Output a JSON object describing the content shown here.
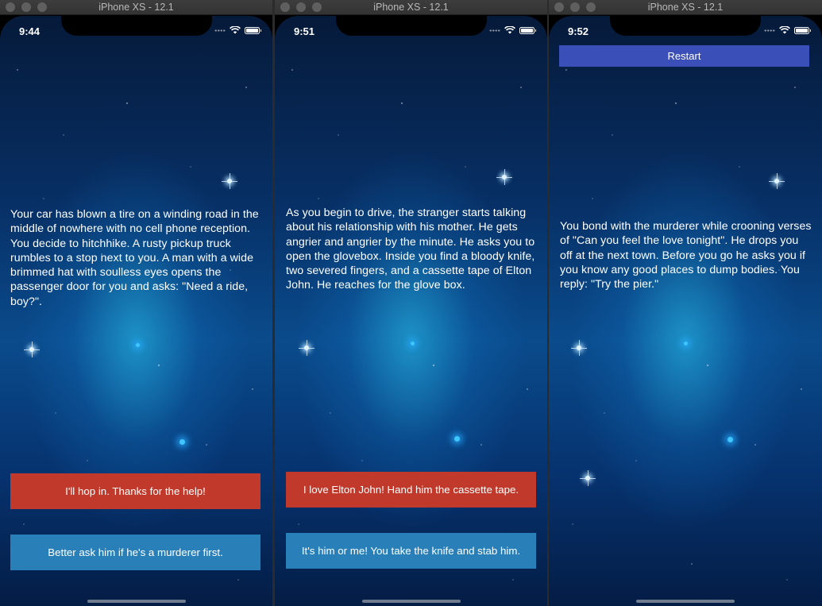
{
  "simulators": [
    {
      "window_title": "iPhone XS - 12.1",
      "time": "9:44",
      "story": "Your car has blown a tire on a winding road in the middle of nowhere with no cell phone reception. You decide to hitchhike. A rusty pickup truck rumbles to a stop next to you. A man with a wide brimmed hat with soulless eyes opens the passenger door for you and asks: \"Need a ride, boy?\".",
      "choice_1": "I'll hop in. Thanks for the help!",
      "choice_2": "Better ask him if he's a murderer first."
    },
    {
      "window_title": "iPhone XS - 12.1",
      "time": "9:51",
      "story": "As you begin to drive, the stranger starts talking about his relationship with his mother. He gets angrier and angrier by the minute. He asks you to open the glovebox. Inside you find a bloody knife, two severed fingers, and a cassette tape of Elton John. He reaches for the glove box.",
      "choice_1": "I love Elton John! Hand him the cassette tape.",
      "choice_2": "It's him or me! You take the knife and stab him."
    },
    {
      "window_title": "iPhone XS - 12.1",
      "time": "9:52",
      "restart_label": "Restart",
      "story": "You bond with the murderer while crooning verses of \"Can you feel the love tonight\". He drops you off at the next town. Before you go he asks you if you know any good places to dump bodies. You reply: \"Try the pier.\""
    }
  ],
  "colors": {
    "choice_1_bg": "#c0392b",
    "choice_2_bg": "#2980b9",
    "restart_bg": "#3b4fb8"
  }
}
